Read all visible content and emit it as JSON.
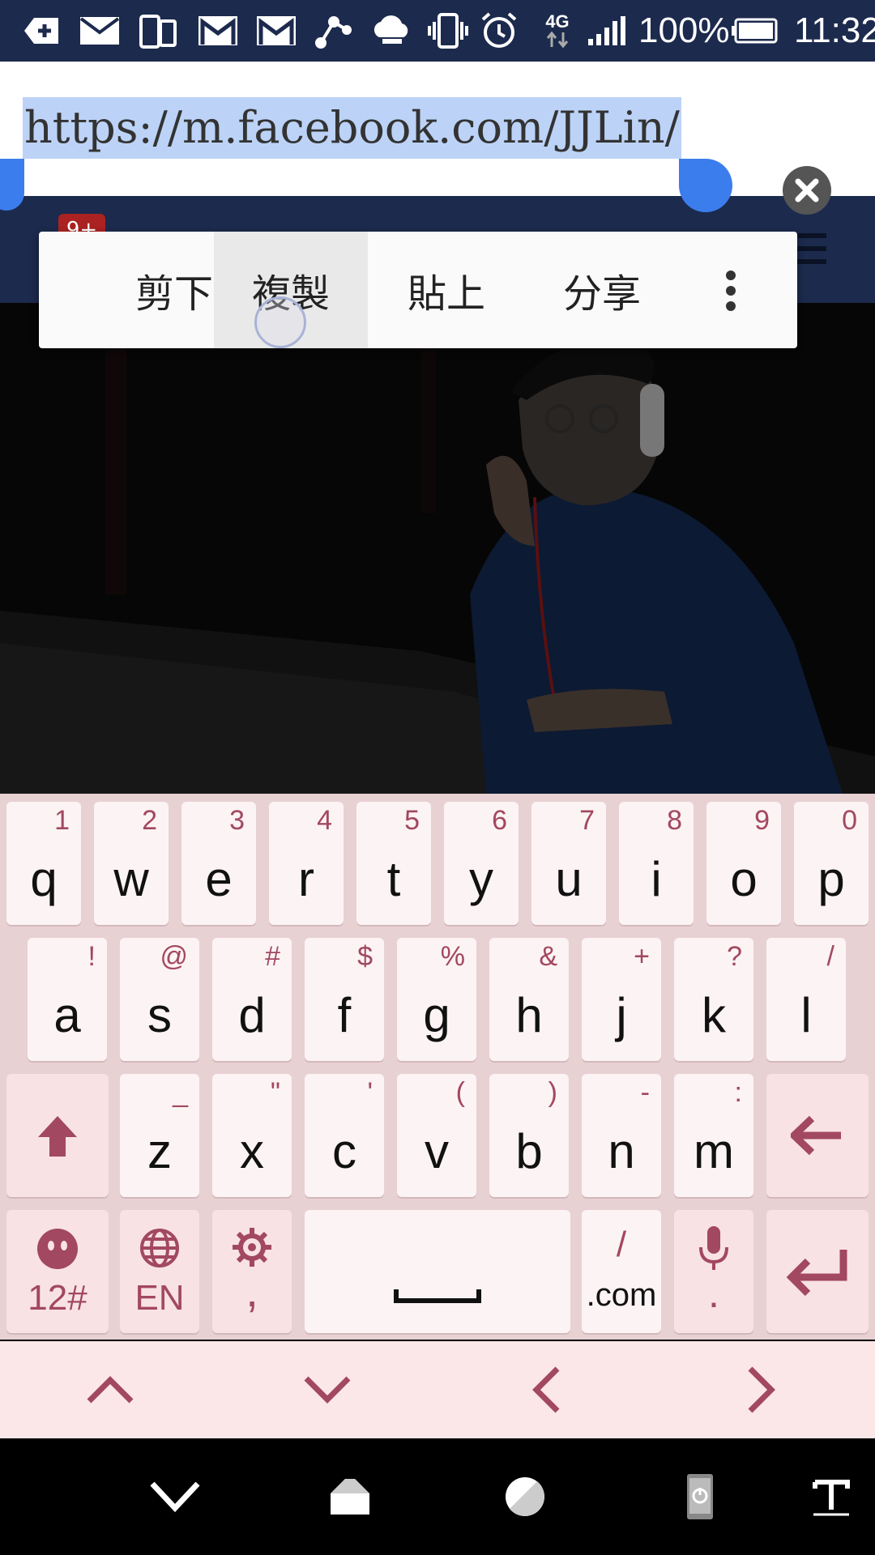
{
  "status_bar": {
    "battery_percent": "100%",
    "time": "11:32",
    "network": "4G",
    "icons": [
      "add-icon",
      "mail-icon",
      "dual-screen-icon",
      "gmail-icon",
      "gmail-icon",
      "share-icon",
      "cloud-sync-icon",
      "vibrate-icon",
      "alarm-icon",
      "data-4g-icon",
      "signal-icon",
      "battery-icon"
    ]
  },
  "url_bar": {
    "url": "https://m.facebook.com/JJLin/",
    "selected": true
  },
  "page": {
    "notification_count": "9+"
  },
  "context_menu": {
    "items": [
      "剪下",
      "複製",
      "貼上",
      "分享"
    ],
    "pressed_index": 1
  },
  "keyboard": {
    "row1": [
      {
        "main": "q",
        "hint": "1"
      },
      {
        "main": "w",
        "hint": "2"
      },
      {
        "main": "e",
        "hint": "3"
      },
      {
        "main": "r",
        "hint": "4"
      },
      {
        "main": "t",
        "hint": "5"
      },
      {
        "main": "y",
        "hint": "6"
      },
      {
        "main": "u",
        "hint": "7"
      },
      {
        "main": "i",
        "hint": "8"
      },
      {
        "main": "o",
        "hint": "9"
      },
      {
        "main": "p",
        "hint": "0"
      }
    ],
    "row2": [
      {
        "main": "a",
        "hint": "!"
      },
      {
        "main": "s",
        "hint": "@"
      },
      {
        "main": "d",
        "hint": "#"
      },
      {
        "main": "f",
        "hint": "$"
      },
      {
        "main": "g",
        "hint": "%"
      },
      {
        "main": "h",
        "hint": "&"
      },
      {
        "main": "j",
        "hint": "+"
      },
      {
        "main": "k",
        "hint": "?"
      },
      {
        "main": "l",
        "hint": "/"
      }
    ],
    "row3": [
      {
        "main": "z",
        "hint": "_"
      },
      {
        "main": "x",
        "hint": "\""
      },
      {
        "main": "c",
        "hint": "'"
      },
      {
        "main": "v",
        "hint": "("
      },
      {
        "main": "b",
        "hint": ")"
      },
      {
        "main": "n",
        "hint": "-"
      },
      {
        "main": "m",
        "hint": ":"
      }
    ],
    "row4": {
      "symbols_label": "12#",
      "language_label": "EN",
      "comma_label": ",",
      "slash_label": "/",
      "com_label": ".com",
      "period_label": "."
    }
  },
  "colors": {
    "accent": "#a24860",
    "selection": "#bcd3f7",
    "handle": "#3b7ded",
    "status_bar": "#1c2a4d"
  }
}
